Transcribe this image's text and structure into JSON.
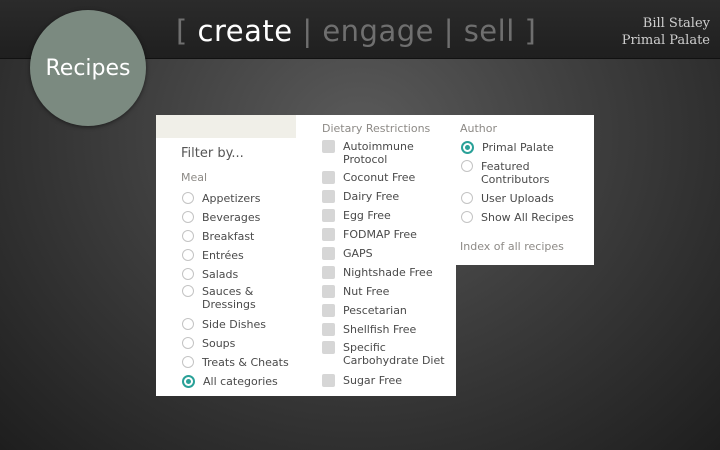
{
  "header": {
    "tagline": {
      "open": "[ ",
      "create": "create",
      "sep1": " | ",
      "engage": "engage",
      "sep2": " | ",
      "sell": "sell",
      "close": " ]"
    },
    "author_name": "Bill Staley",
    "author_company": "Primal Palate"
  },
  "badge": {
    "label": "Recipes"
  },
  "filter": {
    "title": "Filter by...",
    "meal": {
      "heading": "Meal",
      "options": [
        {
          "label": "Appetizers",
          "selected": false
        },
        {
          "label": "Beverages",
          "selected": false
        },
        {
          "label": "Breakfast",
          "selected": false
        },
        {
          "label": "Entrées",
          "selected": false
        },
        {
          "label": "Salads",
          "selected": false
        },
        {
          "label": "Sauces &",
          "label2": "Dressings",
          "selected": false
        },
        {
          "label": "Side Dishes",
          "selected": false
        },
        {
          "label": "Soups",
          "selected": false
        },
        {
          "label": "Treats & Cheats",
          "selected": false
        },
        {
          "label": "All categories",
          "selected": true
        }
      ]
    },
    "dietary": {
      "heading": "Dietary Restrictions",
      "options": [
        {
          "label": "Autoimmune",
          "label2": "Protocol"
        },
        {
          "label": "Coconut Free"
        },
        {
          "label": "Dairy Free"
        },
        {
          "label": "Egg Free"
        },
        {
          "label": "FODMAP Free"
        },
        {
          "label": "GAPS"
        },
        {
          "label": "Nightshade Free"
        },
        {
          "label": "Nut Free"
        },
        {
          "label": "Pescetarian"
        },
        {
          "label": "Shellfish Free"
        },
        {
          "label": "Specific",
          "label2": "Carbohydrate Diet"
        },
        {
          "label": "Sugar Free"
        }
      ]
    },
    "author": {
      "heading": "Author",
      "options": [
        {
          "label": "Primal Palate",
          "selected": true
        },
        {
          "label": "Featured",
          "label2": "Contributors",
          "selected": false
        },
        {
          "label": "User Uploads",
          "selected": false
        },
        {
          "label": "Show All Recipes",
          "selected": false
        }
      ],
      "index_link": "Index of all recipes"
    }
  },
  "colors": {
    "accent": "#2aa198",
    "badge": "#7b8a80"
  }
}
